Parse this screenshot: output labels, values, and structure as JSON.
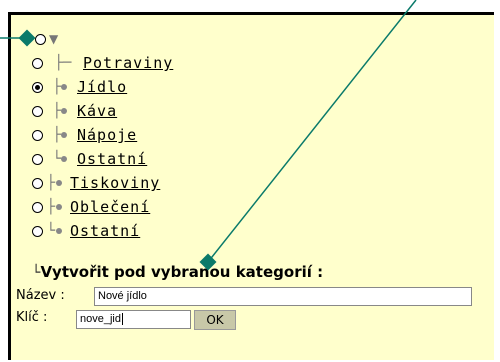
{
  "tree": {
    "items": [
      {
        "label": "Potraviny",
        "prefix": "┬",
        "selected": false
      },
      {
        "label": "Jídlo",
        "prefix": "├●",
        "selected": true
      },
      {
        "label": "Káva",
        "prefix": "├●",
        "selected": false
      },
      {
        "label": "Nápoje",
        "prefix": "├●",
        "selected": false
      },
      {
        "label": "Ostatní",
        "prefix": "└●",
        "selected": false
      },
      {
        "label": "Tiskoviny",
        "prefix": "├●",
        "selected": false
      },
      {
        "label": "Oblečení",
        "prefix": "├●",
        "selected": false
      },
      {
        "label": "Ostatní",
        "prefix": "└●",
        "selected": false
      }
    ]
  },
  "form": {
    "heading": "Vytvořit pod vybranou kategorií :",
    "name_label": "Název :",
    "name_value": "Nové jídlo",
    "key_label": "Klíč :",
    "key_value": "nove_jid",
    "ok_label": "OK"
  },
  "colors": {
    "panel": "#ffffcc",
    "pointer": "#0a7a6a"
  }
}
